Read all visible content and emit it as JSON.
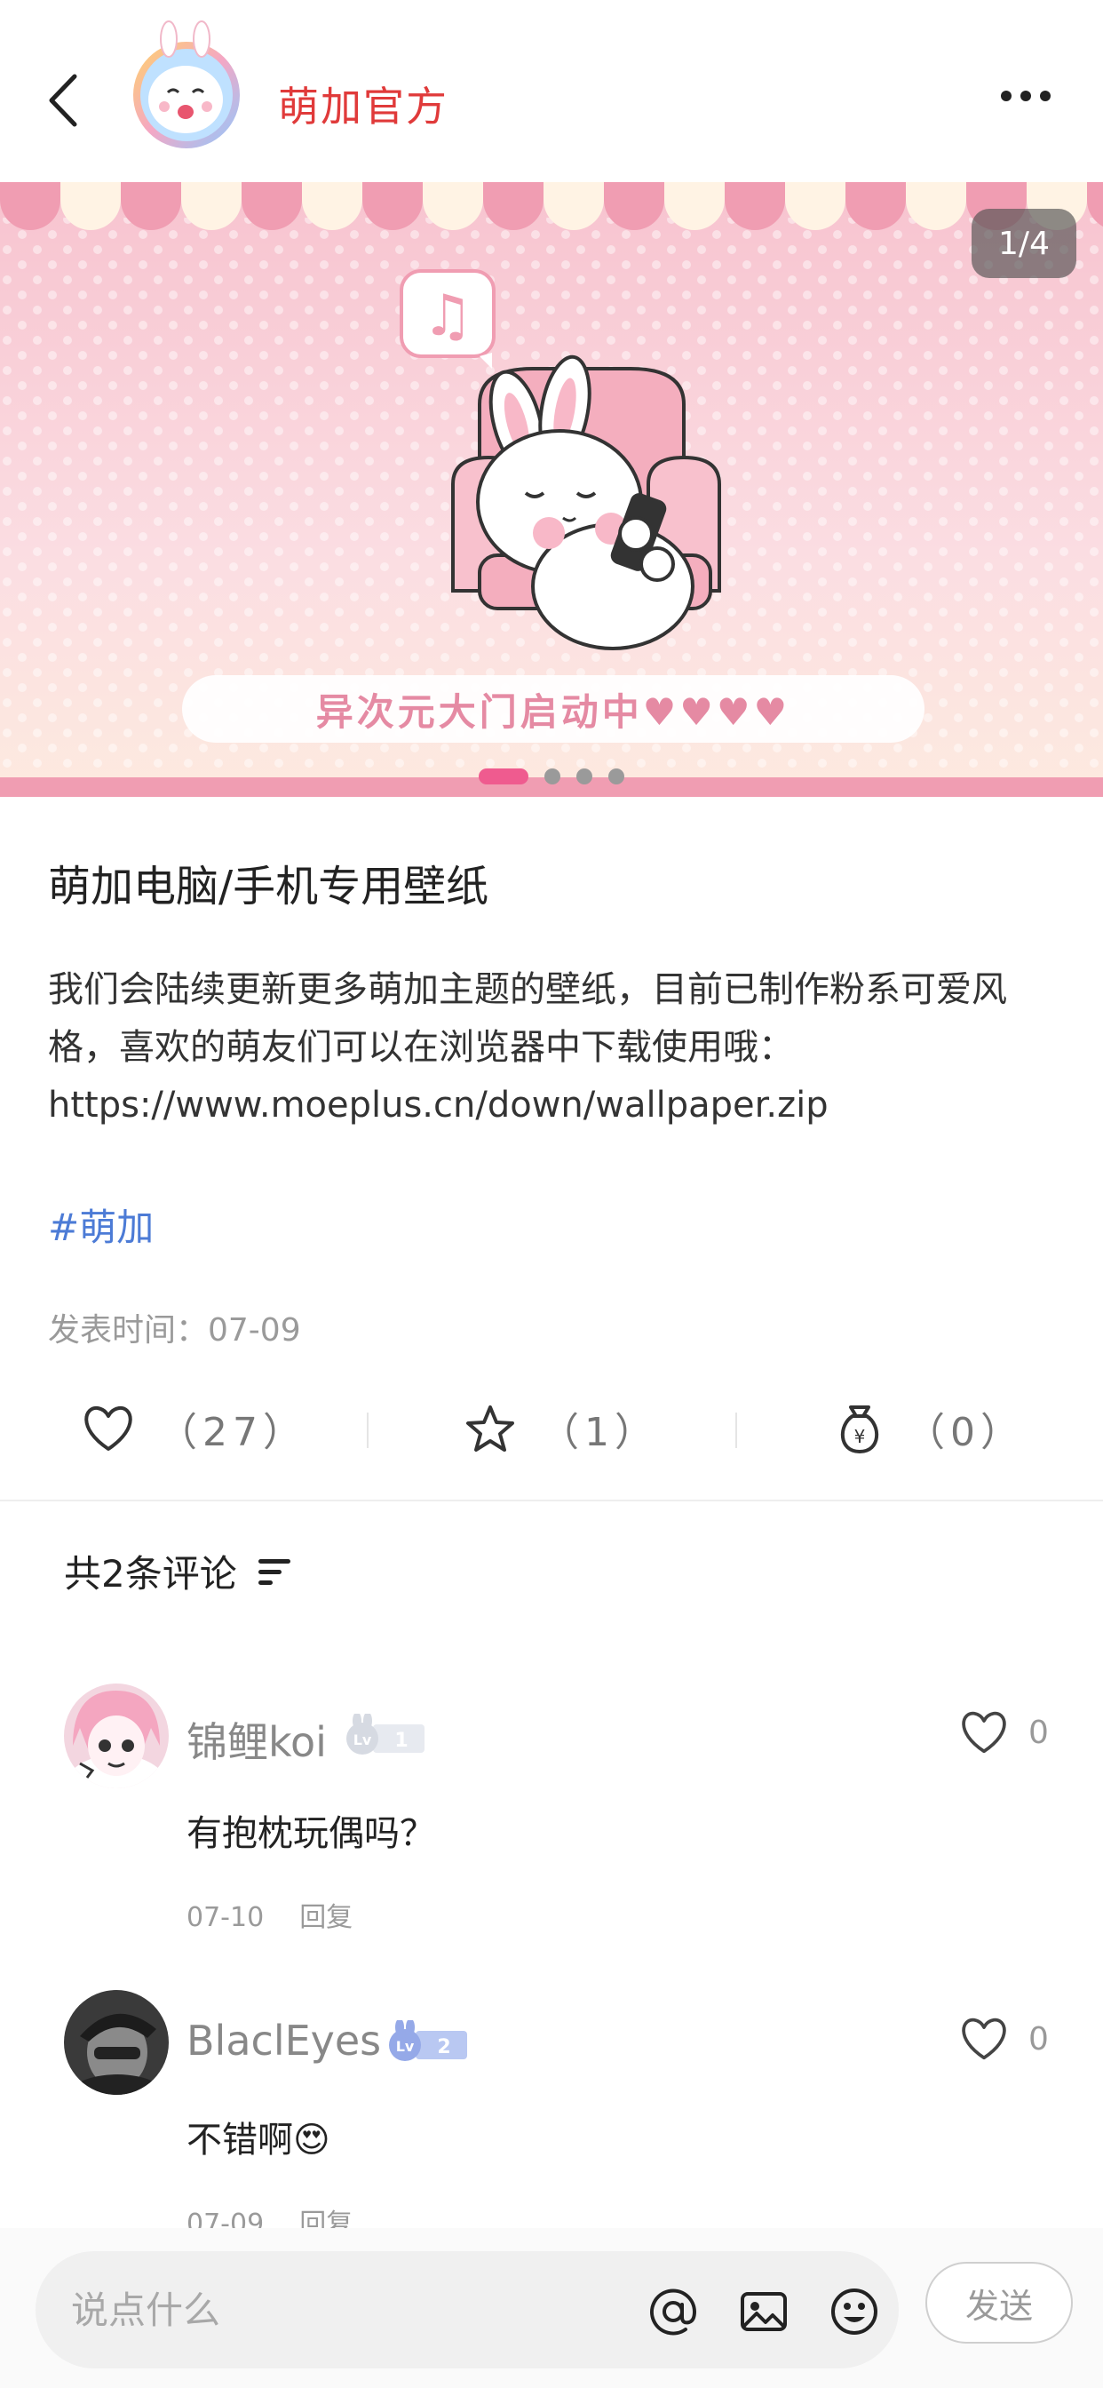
{
  "header": {
    "title": "萌加官方",
    "icons": [
      "back-arrow-icon",
      "more-icon"
    ]
  },
  "banner": {
    "counter": "1/4",
    "caption": "异次元大门启动中♥♥♥♥",
    "page_index": 1,
    "page_total": 4,
    "colors": {
      "accent": "#ef5b8f",
      "bg_top": "#f8c9d4",
      "bg_bottom": "#fde7ea"
    }
  },
  "post": {
    "title": "萌加电脑/手机专用壁纸",
    "body": "我们会陆续更新更多萌加主题的壁纸，目前已制作粉系可爱风格，喜欢的萌友们可以在浏览器中下载使用哦：https://www.moeplus.cn/down/wallpaper.zip",
    "hashtag": "#萌加",
    "time": "发表时间：07-09"
  },
  "actions": {
    "like_count": "（27）",
    "favorite_count": "（1）",
    "reward_count": "（0）"
  },
  "comments": {
    "header": "共2条评论",
    "items": [
      {
        "name": "锦鲤koi",
        "level": "1",
        "text": "有抱枕玩偶吗？",
        "date": "07-10",
        "reply_label": "回复",
        "likes": "0"
      },
      {
        "name": "BlaclEyes",
        "level": "2",
        "text": "不错啊😍",
        "date": "07-09",
        "reply_label": "回复",
        "likes": "0"
      }
    ]
  },
  "composer": {
    "placeholder": "说点什么",
    "send_label": "发送"
  },
  "colors": {
    "title_red": "#e03a3a",
    "hashtag_blue": "#4c7bd6",
    "muted": "#9a9a9a"
  }
}
